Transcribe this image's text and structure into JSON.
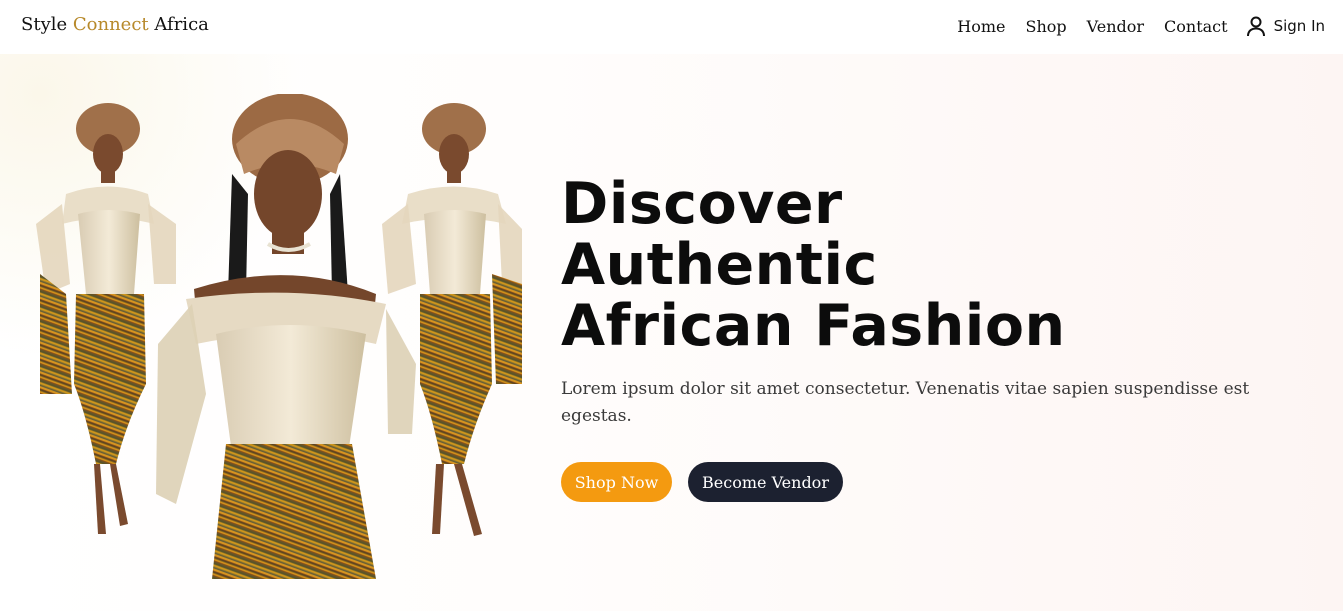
{
  "brand": {
    "part1": "Style ",
    "part2": "Connect",
    "part3": " Africa",
    "accent_color": "#b7892a"
  },
  "nav": {
    "items": [
      {
        "label": "Home"
      },
      {
        "label": "Shop"
      },
      {
        "label": "Vendor"
      },
      {
        "label": "Contact"
      }
    ],
    "signin": {
      "label": "Sign In",
      "icon": "user-icon"
    }
  },
  "hero": {
    "headline_lines": [
      "Discover",
      "Authentic",
      "African Fashion"
    ],
    "subtext": "Lorem ipsum dolor sit amet consectetur. Venenatis vitae sapien suspendisse est egestas.",
    "primary_button": {
      "label": "Shop Now",
      "color": "#f49a10"
    },
    "secondary_button": {
      "label": "Become Vendor",
      "color": "#1c2130"
    },
    "image": {
      "icon": "fashion-models-image"
    }
  }
}
